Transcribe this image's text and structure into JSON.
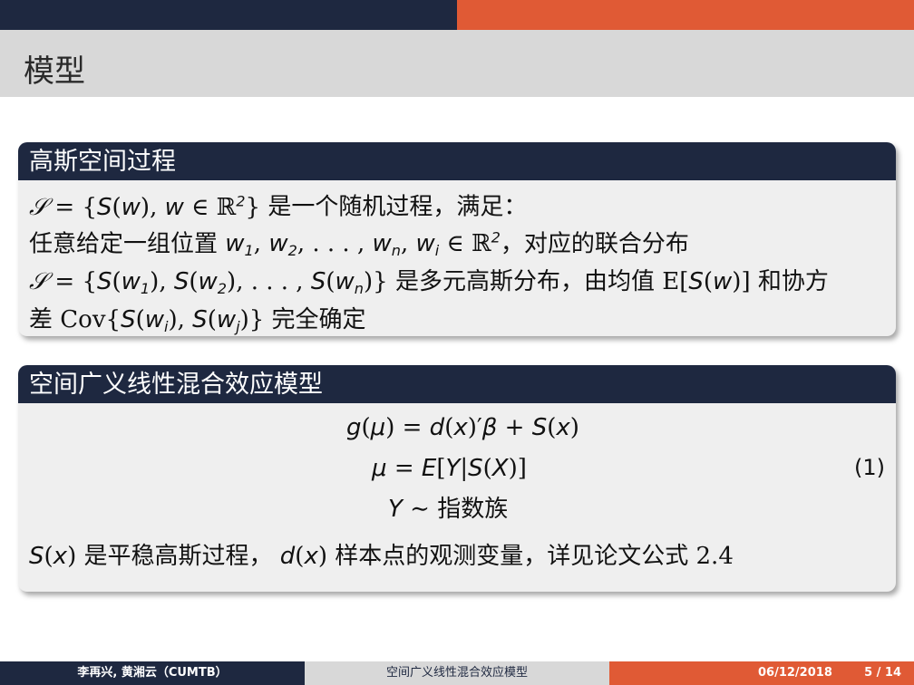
{
  "frame": {
    "title": "模型"
  },
  "block1": {
    "title": "高斯空间过程",
    "line1_text": "是一个随机过程，满足：",
    "line2_prefix": "任意给定一组位置",
    "line2_suffix": "，对应的联合分布",
    "line3_text1": "是多元高斯分布，由均值",
    "line3_text2": "和协方",
    "line4_prefix": "差",
    "line4_suffix": "完全确定"
  },
  "block2": {
    "title": "空间广义线性混合效应模型",
    "eq3_text": "指数族",
    "eq_number": "(1)",
    "note_text1": "是平稳高斯过程，",
    "note_text2": "样本点的观测变量，详见论文公式 2.4"
  },
  "footer": {
    "authors": "李再兴, 黄湘云（CUMTB）",
    "short_title": "空间广义线性混合效应模型",
    "date": "06/12/2018",
    "page": "5 / 14"
  },
  "colors": {
    "navy": "#1e2840",
    "orange": "#e05a35",
    "gray": "#d8d8d8"
  }
}
